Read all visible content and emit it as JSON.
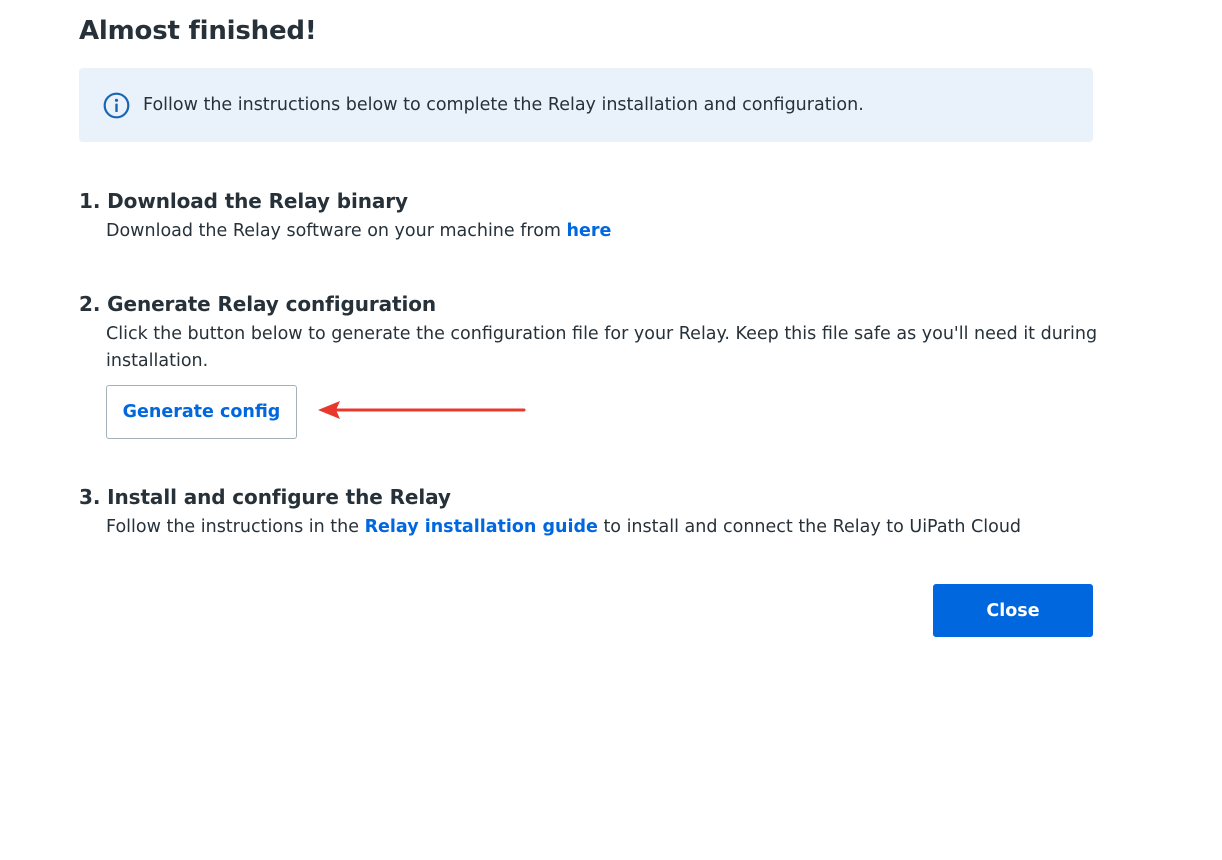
{
  "dialog": {
    "title": "Almost finished!"
  },
  "info_banner": {
    "icon": "info-icon",
    "text": "Follow the instructions below to complete the Relay installation and configuration."
  },
  "steps": [
    {
      "heading": "1. Download the Relay binary",
      "text_before": "Download the Relay software on your machine from ",
      "link_label": "here"
    },
    {
      "heading": "2. Generate Relay configuration",
      "text": "Click the button below to generate the configuration file for your Relay. Keep this file safe as you'll need it during installation.",
      "button_label": "Generate config"
    },
    {
      "heading": "3. Install and configure the Relay",
      "text_before": "Follow the instructions in the ",
      "link_label": "Relay installation guide",
      "text_after": " to install and connect the Relay to UiPath Cloud"
    }
  ],
  "footer": {
    "close_label": "Close"
  },
  "colors": {
    "accent": "#0067df",
    "banner_bg": "#e9f1fa",
    "annotation_arrow": "#e8382c"
  }
}
